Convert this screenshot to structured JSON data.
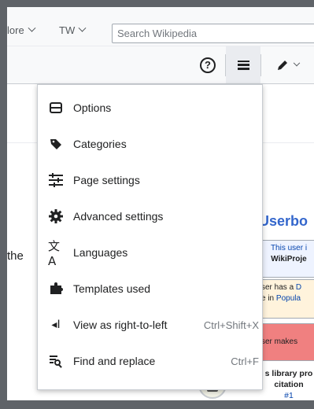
{
  "topbar": {
    "more_label": "lore",
    "tw_label": "TW",
    "search_placeholder": "Search Wikipedia"
  },
  "toolbar": {
    "help_label": "?"
  },
  "page": {
    "the_text": "the",
    "userbox_title": "Userbo",
    "userbox1": {
      "line1": "This user i",
      "line2": "WikiProje"
    },
    "userbox2": {
      "line1_a": "ser has a ",
      "line1_b": "D",
      "line2_a": "e in ",
      "line2_b": "Popula"
    },
    "userbox3": {
      "line1": "ser makes"
    },
    "userbox4": {
      "line1": "s library pro",
      "line2": "citation",
      "line3": "#1"
    }
  },
  "menu": {
    "items": [
      {
        "label": "Options",
        "icon": "options-icon",
        "shortcut": ""
      },
      {
        "label": "Categories",
        "icon": "tag-icon",
        "shortcut": ""
      },
      {
        "label": "Page settings",
        "icon": "page-settings-icon",
        "shortcut": ""
      },
      {
        "label": "Advanced settings",
        "icon": "gear-icon",
        "shortcut": ""
      },
      {
        "label": "Languages",
        "icon": "language-icon",
        "shortcut": ""
      },
      {
        "label": "Templates used",
        "icon": "puzzle-icon",
        "shortcut": ""
      },
      {
        "label": "View as right-to-left",
        "icon": "rtl-icon",
        "shortcut": "Ctrl+Shift+X"
      },
      {
        "label": "Find and replace",
        "icon": "find-replace-icon",
        "shortcut": "Ctrl+F"
      }
    ]
  },
  "colors": {
    "accent": "#3366cc",
    "menu_border": "#c8ccd1",
    "hamburger_active_bg": "#eaecf0"
  }
}
